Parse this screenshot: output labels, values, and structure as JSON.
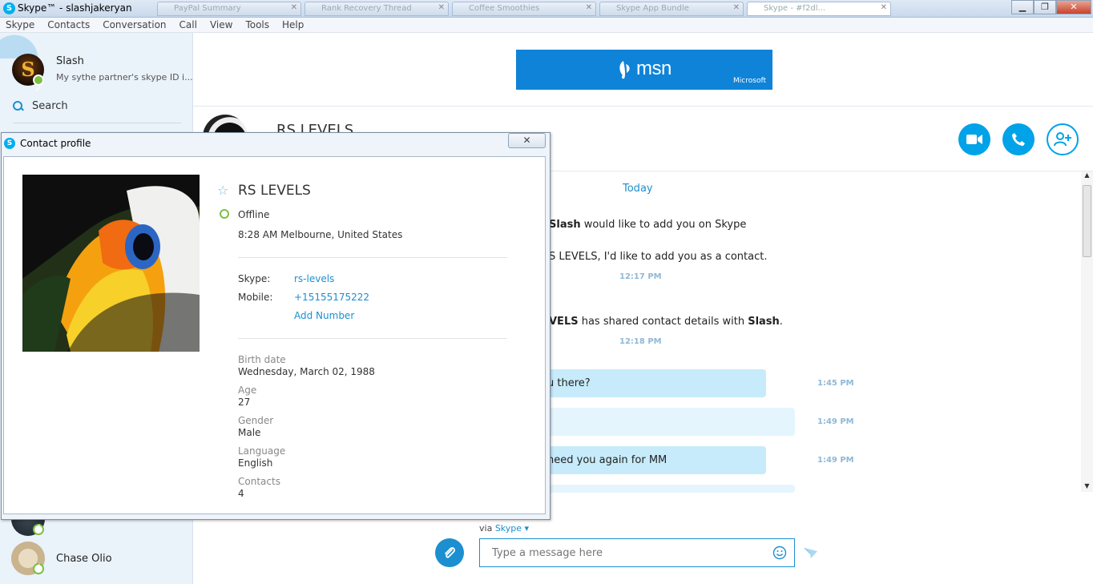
{
  "window": {
    "title": "Skype™ - slashjakeryan",
    "tabs": [
      "PayPal Summary",
      "Rank Recovery Thread",
      "Coffee Smoothies",
      "Skype App Bundle",
      "Skype - #f2dl..."
    ],
    "minimize": "▁",
    "maximize": "❐",
    "close": "✕"
  },
  "menu": [
    "Skype",
    "Contacts",
    "Conversation",
    "Call",
    "View",
    "Tools",
    "Help"
  ],
  "sidebar": {
    "me": {
      "name": "Slash",
      "mood": "My sythe partner's skype ID i...",
      "avatar_letter": "S"
    },
    "search_label": "Search",
    "contacts": [
      {
        "name": "Chase Olio"
      }
    ]
  },
  "ad": {
    "brand": "msn",
    "sub": "Microsoft"
  },
  "conversation": {
    "contact_name": "RS LEVELS",
    "day_label": "Today",
    "system_messages": [
      {
        "bold": "Slash",
        "text": " would like to add you on Skype"
      },
      {
        "text": "S LEVELS, I'd like to add you as a contact.",
        "time": "12:17 PM"
      },
      {
        "bold": "VELS",
        "text": " has shared contact details with ",
        "bold2": "Slash",
        "tail": ".",
        "time": "12:18 PM"
      }
    ],
    "messages": [
      {
        "text": "u there?",
        "time": "1:45 PM"
      },
      {
        "text": "",
        "time": "1:49 PM"
      },
      {
        "text": "need you again for MM",
        "time": "1:49 PM"
      }
    ],
    "via_prefix": "via",
    "via_service": "Skype",
    "input_placeholder": "Type a message here"
  },
  "profile_dialog": {
    "title": "Contact profile",
    "close": "✕",
    "name": "RS LEVELS",
    "status": "Offline",
    "local_time": "8:28 AM Melbourne, United States",
    "skype_label": "Skype:",
    "skype_id": "rs-levels",
    "mobile_label": "Mobile:",
    "mobile": "+15155175222",
    "add_number": "Add Number",
    "fields": [
      {
        "label": "Birth date",
        "value": "Wednesday, March 02, 1988"
      },
      {
        "label": "Age",
        "value": "27"
      },
      {
        "label": "Gender",
        "value": "Male"
      },
      {
        "label": "Language",
        "value": "English"
      },
      {
        "label": "Contacts",
        "value": "4"
      }
    ]
  },
  "colors": {
    "accent": "#00a2e8",
    "link": "#1b8fd0",
    "online": "#7bc043",
    "bubble": "#c7ebfb"
  }
}
